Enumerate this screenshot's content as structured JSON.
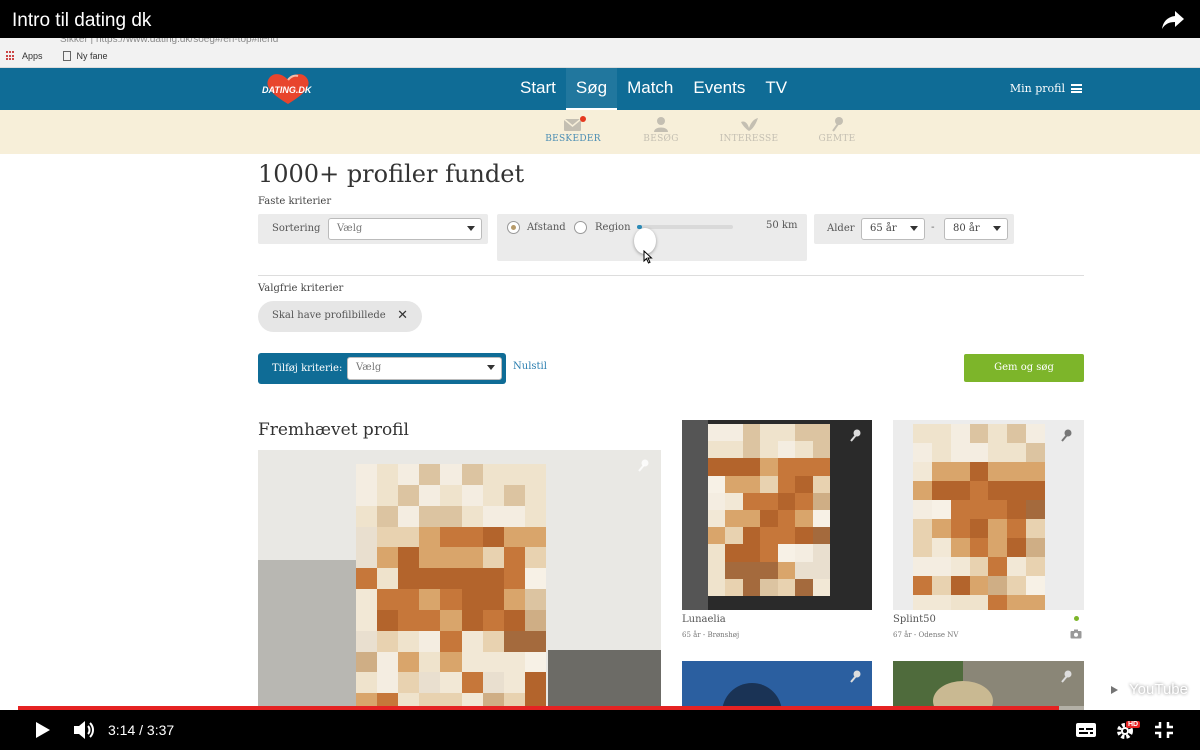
{
  "video": {
    "title": "Intro til dating dk",
    "time_display": "3:14 / 3:37",
    "progress_fraction": 0.894,
    "watermark": "YouTube",
    "hd_badge": "HD"
  },
  "browser": {
    "address": "Sikker | https://www.dating.dk/soeg#/en-top#ilerld",
    "bookmarks": [
      "Apps",
      "Ny fane"
    ]
  },
  "site": {
    "logo_text": "DATING.DK",
    "brand_color": "#0f6c96",
    "nav": [
      "Start",
      "Søg",
      "Match",
      "Events",
      "TV"
    ],
    "active_nav": "Søg",
    "profile_menu": "Min profil",
    "sub_nav": [
      "BESKEDER",
      "BESØG",
      "INTERESSE",
      "GEMTE"
    ]
  },
  "search": {
    "heading": "1000+ profiler fundet",
    "fixed_label": "Faste kriterier",
    "sort_label": "Sortering",
    "sort_value": "Vælg",
    "radio_distance": "Afstand",
    "radio_region": "Region",
    "distance_value": "50 km",
    "distance_fraction": 0.05,
    "age_label": "Alder",
    "age_from": "65 år",
    "age_to": "80 år",
    "age_dash": "-",
    "optional_label": "Valgfrie kriterier",
    "chip_label": "Skal have profilbillede",
    "chip_close": "✕",
    "add_label": "Tilføj kriterie:",
    "add_value": "Vælg",
    "reset_label": "Nulstil",
    "submit_label": "Gem og søg",
    "submit_color": "#7db52a"
  },
  "results": {
    "featured_heading": "Fremhævet profil",
    "cards": [
      {
        "name": "Lunaelia",
        "meta": "65 år - Brønshøj",
        "online": false
      },
      {
        "name": "Splint50",
        "meta": "67 år - Odense NV",
        "online": true
      }
    ]
  }
}
